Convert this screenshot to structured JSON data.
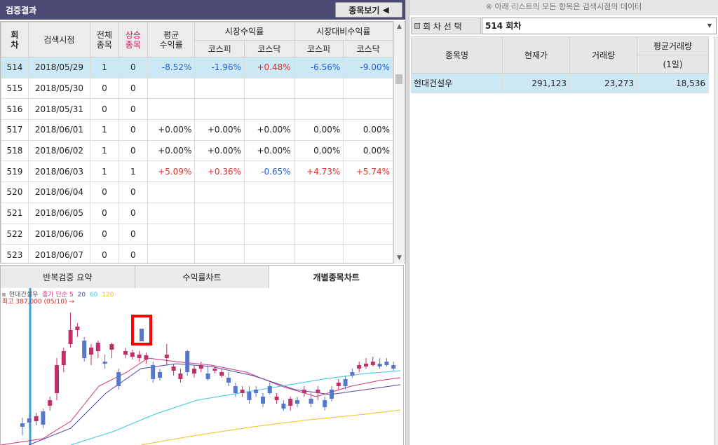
{
  "left": {
    "title": "검증결과",
    "view_button": "종목보기",
    "view_button_icon": "◀",
    "headers": {
      "round": "회\n차",
      "date": "검색시점",
      "total": "전체\n종목",
      "up": "상승\n종목",
      "avg": "평균\n수익률",
      "market_group": "시장수익률",
      "relative_group": "시장대비수익률",
      "kospi": "코스피",
      "kosdaq": "코스닥",
      "kospi2": "코스피",
      "kosdaq2": "코스닥"
    },
    "rows": [
      {
        "round": "514",
        "date": "2018/05/29",
        "total": "1",
        "up": "0",
        "avg": "-8.52%",
        "m_kospi": "-1.96%",
        "m_kosdaq": "+0.48%",
        "r_kospi": "-6.56%",
        "r_kosdaq": "-9.00%"
      },
      {
        "round": "515",
        "date": "2018/05/30",
        "total": "0",
        "up": "0",
        "avg": "",
        "m_kospi": "",
        "m_kosdaq": "",
        "r_kospi": "",
        "r_kosdaq": ""
      },
      {
        "round": "516",
        "date": "2018/05/31",
        "total": "0",
        "up": "0",
        "avg": "",
        "m_kospi": "",
        "m_kosdaq": "",
        "r_kospi": "",
        "r_kosdaq": ""
      },
      {
        "round": "517",
        "date": "2018/06/01",
        "total": "1",
        "up": "0",
        "avg": "+0.00%",
        "m_kospi": "+0.00%",
        "m_kosdaq": "+0.00%",
        "r_kospi": "0.00%",
        "r_kosdaq": "0.00%"
      },
      {
        "round": "518",
        "date": "2018/06/02",
        "total": "1",
        "up": "0",
        "avg": "+0.00%",
        "m_kospi": "+0.00%",
        "m_kosdaq": "+0.00%",
        "r_kospi": "0.00%",
        "r_kosdaq": "0.00%"
      },
      {
        "round": "519",
        "date": "2018/06/03",
        "total": "1",
        "up": "1",
        "avg": "+5.09%",
        "m_kospi": "+0.36%",
        "m_kosdaq": "-0.65%",
        "r_kospi": "+4.73%",
        "r_kosdaq": "+5.74%"
      },
      {
        "round": "520",
        "date": "2018/06/04",
        "total": "0",
        "up": "0",
        "avg": "",
        "m_kospi": "",
        "m_kosdaq": "",
        "r_kospi": "",
        "r_kosdaq": ""
      },
      {
        "round": "521",
        "date": "2018/06/05",
        "total": "0",
        "up": "0",
        "avg": "",
        "m_kospi": "",
        "m_kosdaq": "",
        "r_kospi": "",
        "r_kosdaq": ""
      },
      {
        "round": "522",
        "date": "2018/06/06",
        "total": "0",
        "up": "0",
        "avg": "",
        "m_kospi": "",
        "m_kosdaq": "",
        "r_kospi": "",
        "r_kosdaq": ""
      },
      {
        "round": "523",
        "date": "2018/06/07",
        "total": "0",
        "up": "0",
        "avg": "",
        "m_kospi": "",
        "m_kosdaq": "",
        "r_kospi": "",
        "r_kosdaq": ""
      }
    ],
    "tabs": [
      "반복검증 요약",
      "수익률차트",
      "개별종목차트"
    ],
    "active_tab": 2,
    "chart": {
      "legend_name": "현대건설우",
      "legend_price": "종가 단순",
      "ma": [
        "5",
        "20",
        "60",
        "120"
      ],
      "ma_colors": [
        "#d4307a",
        "#4a4aa8",
        "#36c8e8",
        "#f0c020"
      ],
      "max_label": "최고 387,000 (05/10)",
      "max_arrow": "→",
      "up_color": "#c0306a",
      "down_color": "#5577cc"
    }
  },
  "right": {
    "note": "※ 아래 리스트의 모든 항목은 검색시점의 데이터",
    "round_label": "회 차 선 택",
    "round_value": "514 회차",
    "dropdown_icon": "▼",
    "headers": {
      "name": "종목명",
      "price": "현재가",
      "volume": "거래량",
      "avg_volume": "평균거래량",
      "avg_volume_sub": "(1일)"
    },
    "rows": [
      {
        "name": "현대건설우",
        "price": "291,123",
        "volume": "23,273",
        "avg_volume": "18,536"
      }
    ]
  }
}
